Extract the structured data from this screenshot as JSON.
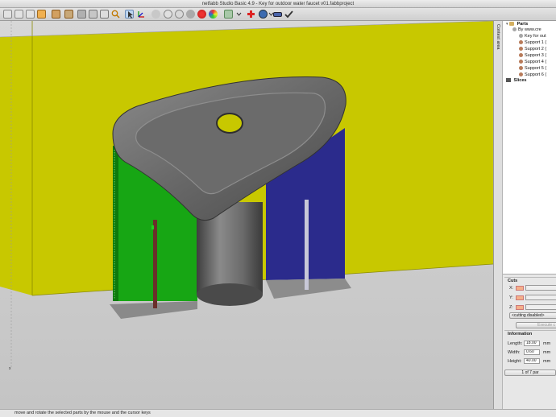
{
  "window": {
    "title": "netfabb Studio Basic 4.9 - Key for outdoor water faucet v01.fabbproject"
  },
  "toolbar": {
    "icons": [
      "new-project",
      "open-project",
      "save-project",
      "save-as",
      "add-part",
      "export-part",
      "repair",
      "view-box",
      "zoom",
      "select",
      "move",
      "cut",
      "measure",
      "color",
      "visibility",
      "undo",
      "add-support",
      "settings",
      "help",
      "apply"
    ]
  },
  "viewport": {
    "floor_color": "#cccc00",
    "key_color": "#5a5a5a",
    "support_left_color": "#11a010",
    "support_right_color": "#2c2c90",
    "axis_x_label": "x"
  },
  "context_tab": {
    "label": "Context area"
  },
  "parts_tree": {
    "parts_label": "Parts",
    "items": [
      {
        "label": "By www.cre",
        "dot": "#a6a6a6"
      },
      {
        "label": "Key for out",
        "dot": "#a6a6a6"
      },
      {
        "label": "Support 1 (",
        "dot": "#b77b5a"
      },
      {
        "label": "Support 2 (",
        "dot": "#b77b5a"
      },
      {
        "label": "Support 3 (",
        "dot": "#b77b5a"
      },
      {
        "label": "Support 4 (",
        "dot": "#b77b5a"
      },
      {
        "label": "Support 5 (",
        "dot": "#b77b5a"
      },
      {
        "label": "Support 6 (",
        "dot": "#b77b5a"
      }
    ],
    "slices_label": "Slices"
  },
  "cuts": {
    "title": "Cuts",
    "x_label": "X:",
    "y_label": "Y:",
    "z_label": "Z:",
    "mode_value": "<cutting disabled>",
    "execute_label": "Execute c"
  },
  "information": {
    "title": "Information",
    "length_label": "Length:",
    "length_value": "18.00",
    "length_unit": "mm",
    "width_label": "Width:",
    "width_value": "0.60",
    "width_unit": "mm",
    "height_label": "Height:",
    "height_value": "40.00",
    "height_unit": "mm",
    "counter": "1 of 7 par"
  },
  "status": {
    "text": "move and rotate the selected parts by the mouse and the cursor keys"
  }
}
